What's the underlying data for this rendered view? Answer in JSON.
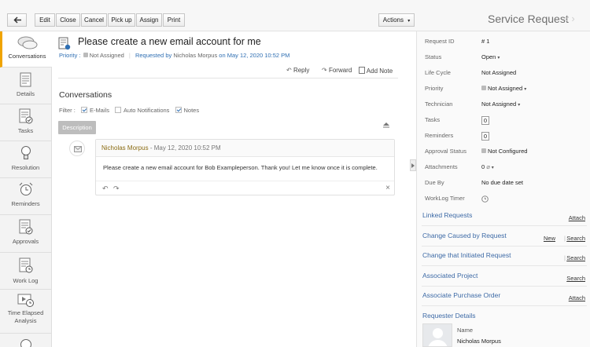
{
  "toolbar": {
    "buttons": [
      {
        "label": "Edit"
      },
      {
        "label": "Close"
      },
      {
        "label": "Cancel"
      },
      {
        "label": "Pick up"
      },
      {
        "label": "Assign"
      },
      {
        "label": "Print"
      }
    ],
    "actions_label": "Actions",
    "page_title": "Service Request"
  },
  "sidebar": {
    "items": [
      {
        "label": "Conversations",
        "icon": "conversations-icon"
      },
      {
        "label": "Details",
        "icon": "details-icon"
      },
      {
        "label": "Tasks",
        "icon": "tasks-icon"
      },
      {
        "label": "Resolution",
        "icon": "lightbulb-icon"
      },
      {
        "label": "Reminders",
        "icon": "alarm-clock-icon"
      },
      {
        "label": "Approvals",
        "icon": "approvals-icon"
      },
      {
        "label": "Work Log",
        "icon": "worklog-icon"
      },
      {
        "label": "Time Elapsed",
        "label2": "Analysis",
        "icon": "time-elapsed-icon"
      }
    ]
  },
  "request": {
    "title": "Please create a new email account for me",
    "priority_label": "Priority :",
    "priority_value": "Not Assigned",
    "requested_by_label": "Requested by",
    "requester": "Nicholas Morpus",
    "on_label": "on",
    "date": "May 12, 2020 10:52 PM"
  },
  "actions": {
    "reply": "Reply",
    "forward": "Forward",
    "add_note": "Add Note"
  },
  "conversations": {
    "heading": "Conversations",
    "filter_label": "Filter :",
    "filters": [
      {
        "label": "E-Mails",
        "checked": true
      },
      {
        "label": "Auto Notifications",
        "checked": false
      },
      {
        "label": "Notes",
        "checked": true
      }
    ],
    "description_button": "Description",
    "entry": {
      "author": "Nicholas Morpus",
      "separator": "-",
      "date": "May 12, 2020 10:52 PM",
      "body": "Please create a new email account for Bob Exampleperson. Thank you! Let me know once it is complete."
    }
  },
  "properties": [
    {
      "key": "Request ID",
      "value": "# 1"
    },
    {
      "key": "Status",
      "value": "Open"
    },
    {
      "key": "Life Cycle",
      "value": "Not Assigned"
    },
    {
      "key": "Priority",
      "value": "Not Assigned"
    },
    {
      "key": "Technician",
      "value": "Not Assigned"
    },
    {
      "key": "Tasks",
      "value": "0"
    },
    {
      "key": "Reminders",
      "value": "0"
    },
    {
      "key": "Approval Status",
      "value": "Not Configured"
    },
    {
      "key": "Attachments",
      "value": "0"
    },
    {
      "key": "Due By",
      "value": "No due date set"
    },
    {
      "key": "WorkLog Timer",
      "value": ""
    }
  ],
  "sections": [
    {
      "title": "Linked Requests",
      "links": [
        "Attach"
      ]
    },
    {
      "title": "Change Caused by Request",
      "links": [
        "New",
        "Search"
      ]
    },
    {
      "title": "Change that Initiated Request",
      "links": [
        "Search"
      ]
    },
    {
      "title": "Associated Project",
      "links": [
        "Search"
      ]
    },
    {
      "title": "Associate Purchase Order",
      "links": [
        "Attach"
      ]
    }
  ],
  "requester_details": {
    "title": "Requester Details",
    "name_label": "Name",
    "name_value": "Nicholas Morpus"
  },
  "colors": {
    "accent": "#f0a400",
    "link_blue": "#2f6fb3",
    "section_blue": "#3d6aa6"
  }
}
